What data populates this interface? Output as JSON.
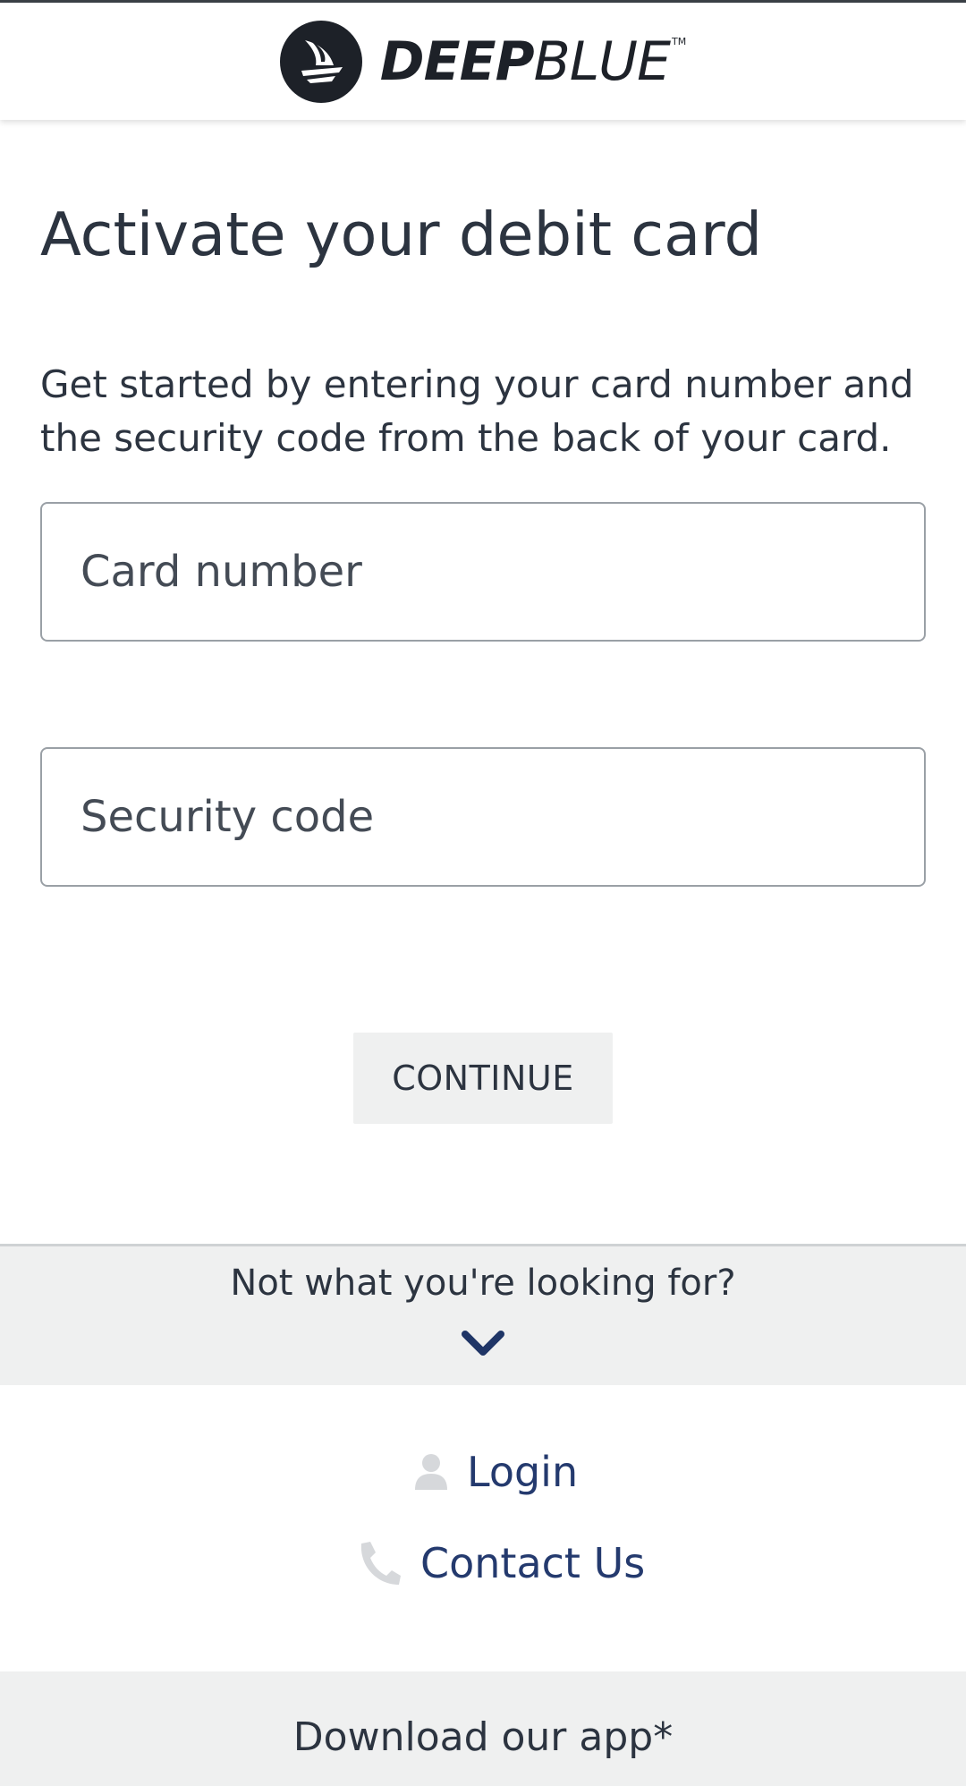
{
  "header": {
    "brand_bold": "DEEP",
    "brand_light": "BLUE",
    "brand_tm": "TM"
  },
  "main": {
    "title": "Activate your debit card",
    "intro": "Get started by entering your card number and the security code from the back of your card.",
    "card_field": {
      "placeholder": "Card number",
      "value": ""
    },
    "security_field": {
      "placeholder": "Security code",
      "value": ""
    },
    "continue_label": "CONTINUE"
  },
  "looking": {
    "text": "Not what you're looking for?",
    "chevron_icon": "chevron-down-icon"
  },
  "links": {
    "login": {
      "label": "Login",
      "icon": "user-icon"
    },
    "contact": {
      "label": "Contact Us",
      "icon": "phone-icon"
    }
  },
  "download": {
    "label": "Download our app*"
  },
  "colors": {
    "text": "#2c3440",
    "link": "#243a6e",
    "panel_bg": "#eff0f0",
    "icon_gray": "#d6d8db",
    "brand_dark": "#1d2128"
  }
}
